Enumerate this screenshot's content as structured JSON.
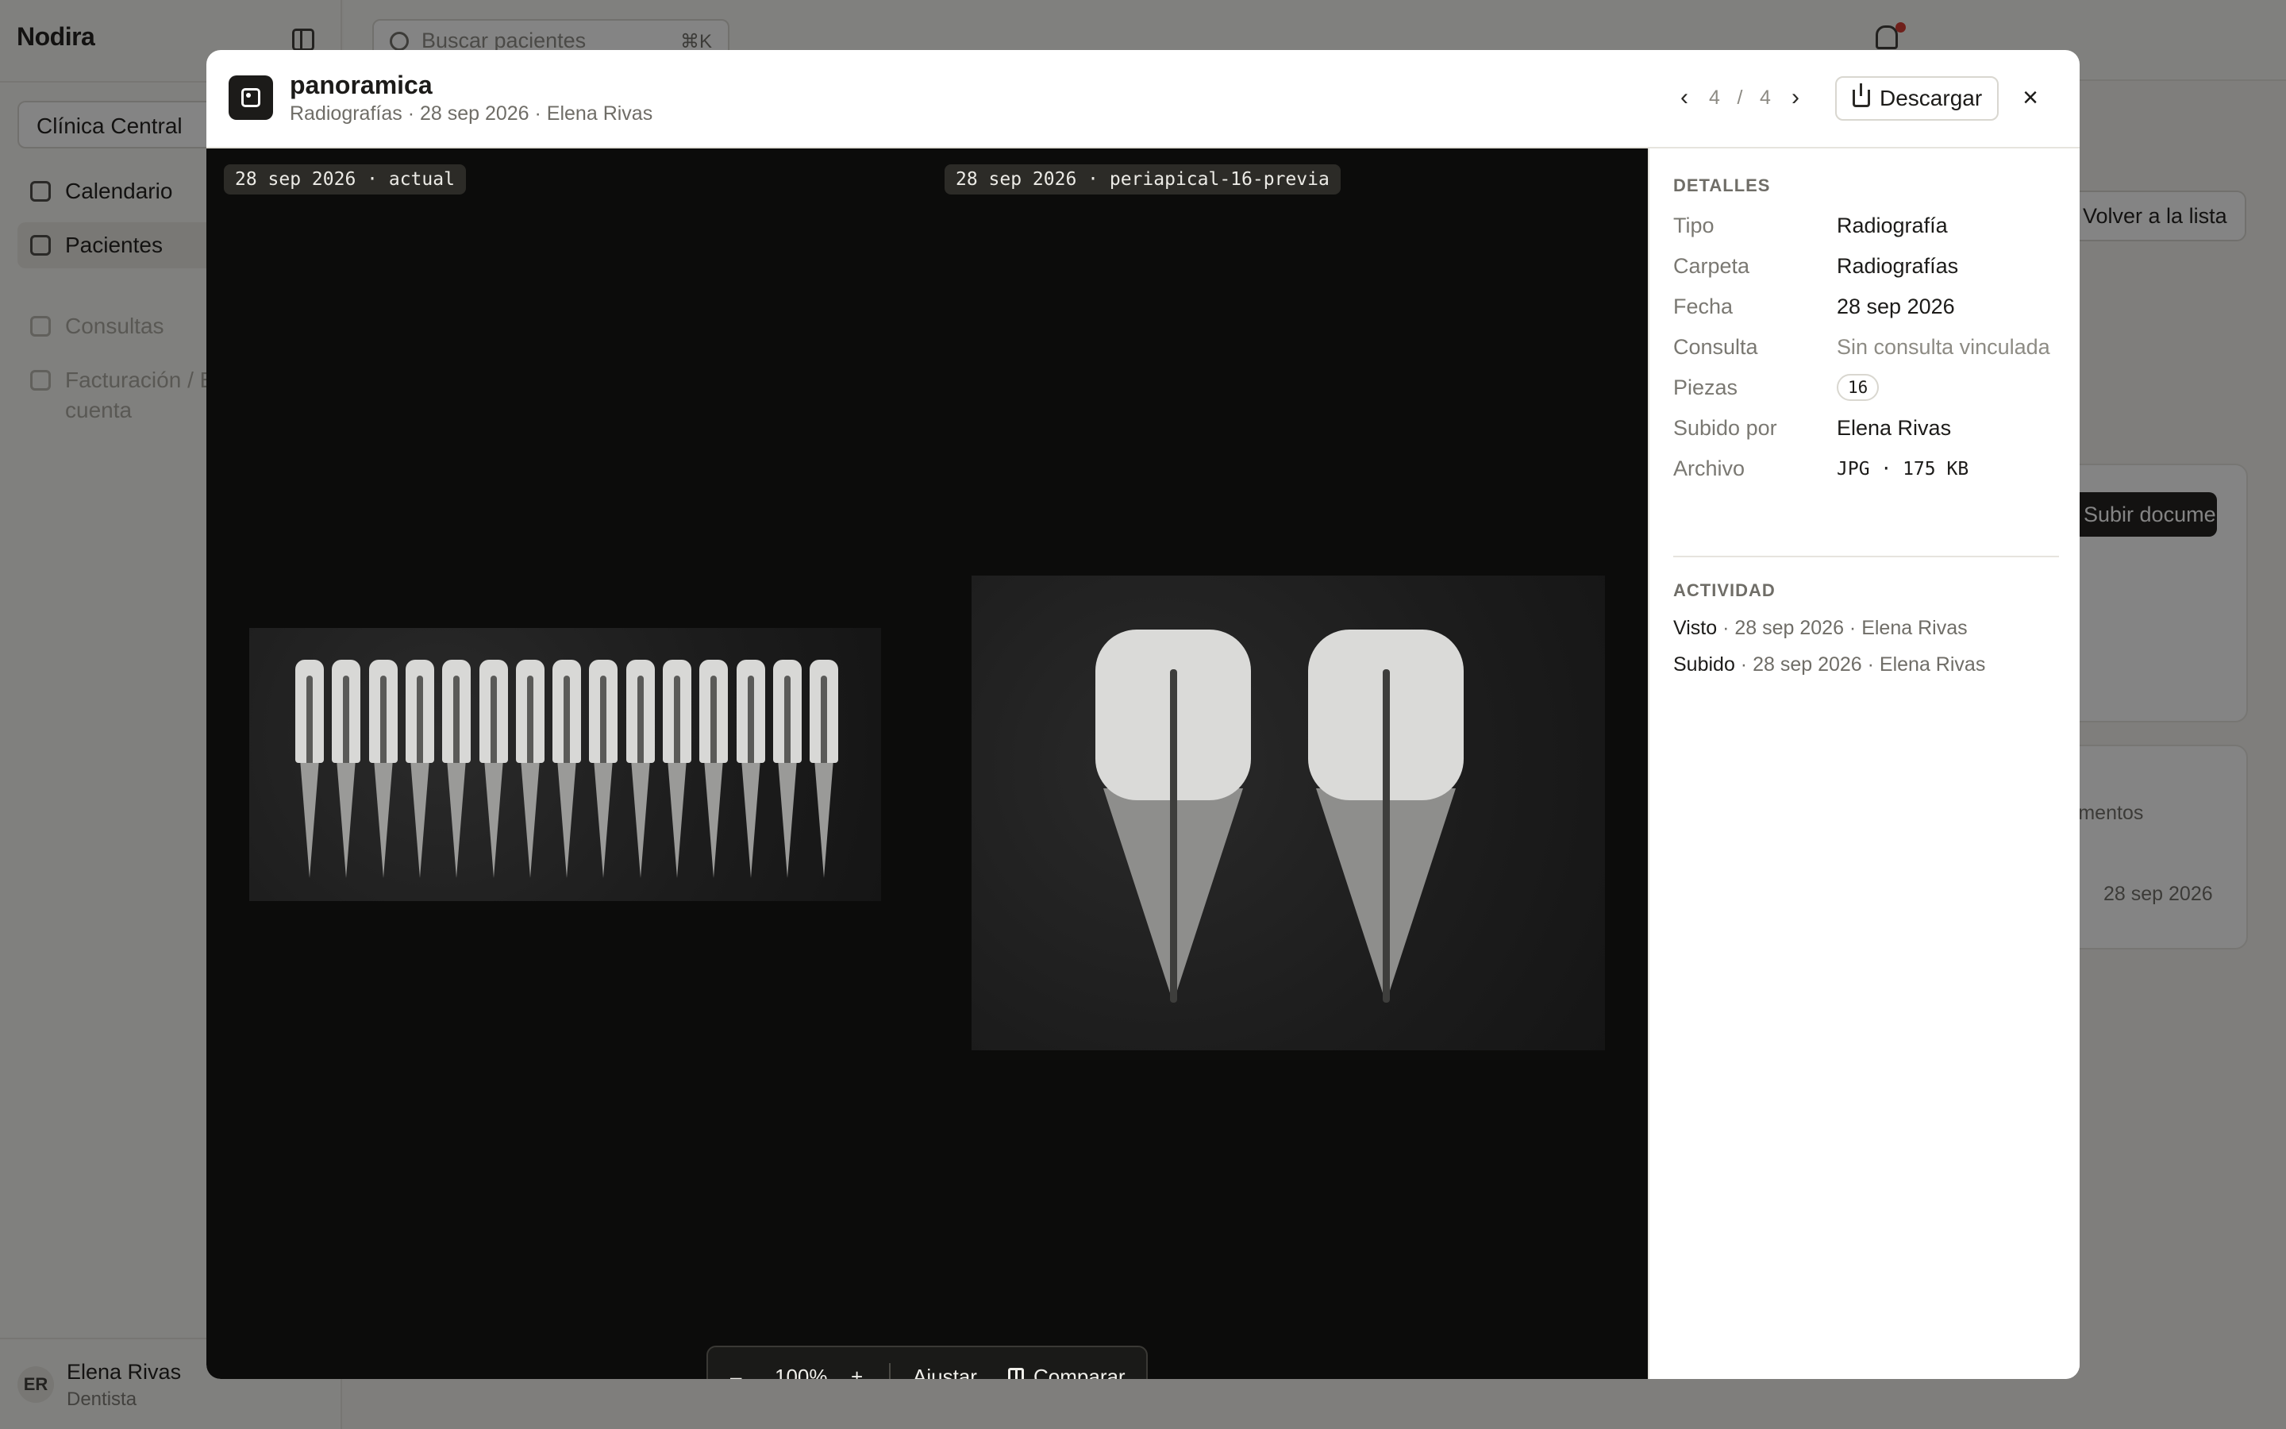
{
  "app": {
    "brand": "Nodira",
    "clinic": "Clínica Central",
    "nav": [
      {
        "label": "Calendario"
      },
      {
        "label": "Pacientes"
      },
      {
        "label": "Consultas"
      },
      {
        "label": "Facturación / Estado de cuenta"
      }
    ],
    "search": {
      "placeholder": "Buscar pacientes",
      "shortcut": "⌘K"
    },
    "user": {
      "initials": "ER",
      "name": "Elena Rivas",
      "role": "Dentista"
    },
    "bg": {
      "back_button": "Volver a la lista",
      "add_document": "Subir documento",
      "documents_label": "Documentos",
      "date": "28 sep 2026"
    }
  },
  "modal": {
    "title": "panoramica",
    "subtitle": "Radiografías · 28 sep 2026 · Elena Rivas",
    "pager": {
      "current": "4",
      "separator": "/",
      "total": "4"
    },
    "download_label": "Descargar",
    "close_symbol": "×",
    "viewer": {
      "left_tag": "28 sep 2026 · actual",
      "right_tag": "28 sep 2026 · periapical-16-previa",
      "toolbar": {
        "zoom_out": "–",
        "zoom": "100%",
        "zoom_in": "+",
        "fit": "Ajustar",
        "compare": "Comparar"
      }
    },
    "details": {
      "heading": "DETALLES",
      "rows": [
        {
          "key": "Tipo",
          "value": "Radiografía"
        },
        {
          "key": "Carpeta",
          "value": "Radiografías"
        },
        {
          "key": "Fecha",
          "value": "28 sep 2026"
        },
        {
          "key": "Consulta",
          "value": "Sin consulta vinculada"
        },
        {
          "key": "Piezas",
          "value": "16"
        },
        {
          "key": "Subido por",
          "value": "Elena Rivas"
        },
        {
          "key": "Archivo",
          "value": "JPG · 175 KB"
        }
      ],
      "activity_heading": "ACTIVIDAD",
      "activity": [
        {
          "action": "Visto",
          "meta": " · 28 sep 2026 · Elena Rivas"
        },
        {
          "action": "Subido",
          "meta": " · 28 sep 2026 · Elena Rivas"
        }
      ]
    }
  },
  "icons": {
    "file": "image-icon",
    "prev": "chevron-left-icon",
    "next": "chevron-right-icon",
    "download": "download-icon",
    "compare": "columns-icon",
    "notifications": "bell-icon"
  },
  "colors": {
    "overlay": "#0a0a09",
    "viewer_bg": "#0c0c0b",
    "accent_dark": "#1c1b19",
    "notification_dot": "#d4372c"
  }
}
